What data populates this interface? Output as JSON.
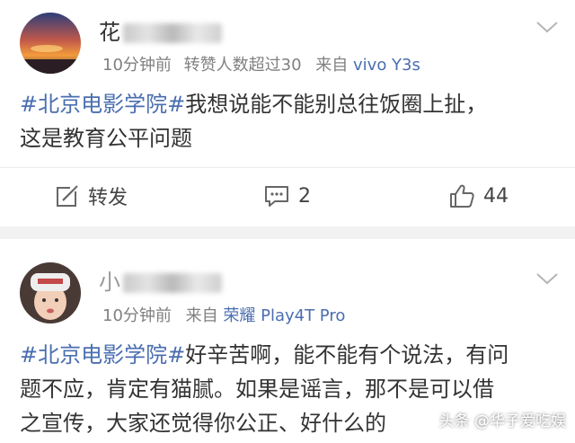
{
  "posts": [
    {
      "username": "花",
      "time": "10分钟前",
      "extra": "转赞人数超过30",
      "source_prefix": "来自",
      "source": "vivo Y3s",
      "hashtag": "#北京电影学院#",
      "text_line1": "我想说能不能别总往饭圈上扯，",
      "text_line2": "这是教育公平问题",
      "repost_label": "转发",
      "comment_count": "2",
      "like_count": "44"
    },
    {
      "username": "小",
      "time": "10分钟前",
      "source_prefix": "来自",
      "source": "荣耀 Play4T Pro",
      "hashtag": "#北京电影学院#",
      "text_line1": "好辛苦啊，能不能有个说法，有问",
      "text_line2": "题不应，肯定有猫腻。如果是谣言，那不是可以借",
      "text_line3": "之宣传，大家还觉得你公正、好什么的"
    }
  ],
  "watermark": "头条 @华子爱吃娱",
  "colors": {
    "link": "#4a6eb0",
    "meta": "#808080",
    "separator": "#f2f2f2"
  }
}
